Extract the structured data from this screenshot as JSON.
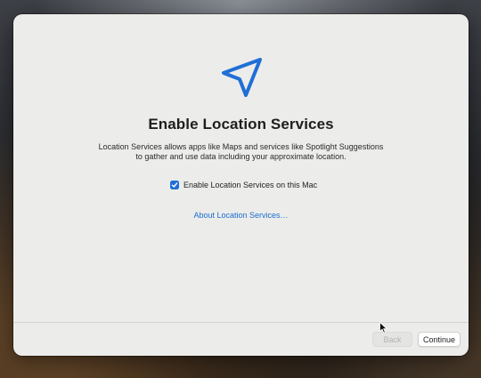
{
  "setup": {
    "title": "Enable Location Services",
    "description": "Location Services allows apps like Maps and services like Spotlight Suggestions to gather and use data including your approximate location.",
    "checkbox_label": "Enable Location Services on this Mac",
    "checkbox_checked": true,
    "link_label": "About Location Services…",
    "hero_icon": "location-arrow-icon"
  },
  "footer": {
    "back_label": "Back",
    "back_enabled": false,
    "continue_label": "Continue"
  },
  "colors": {
    "accent": "#1f6fd6",
    "link": "#1a6ed0",
    "window_bg": "#ececea"
  }
}
